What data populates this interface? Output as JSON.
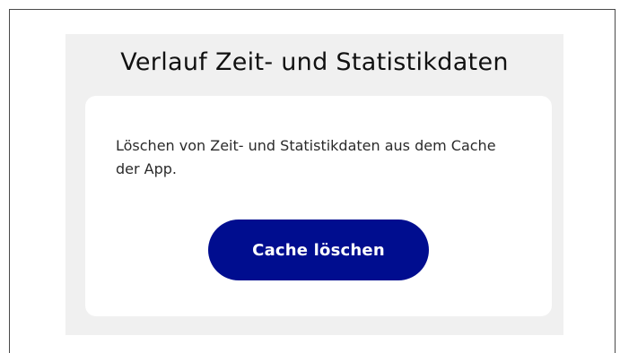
{
  "section": {
    "title": "Verlauf Zeit- und Statistikdaten",
    "description": "Löschen von Zeit- und Statistikdaten aus dem Cache der App.",
    "button_label": "Cache löschen"
  },
  "colors": {
    "page_background": "#ffffff",
    "section_background": "#f0f0f0",
    "card_background": "#ffffff",
    "button_background": "#000d8f",
    "button_text": "#ffffff"
  }
}
